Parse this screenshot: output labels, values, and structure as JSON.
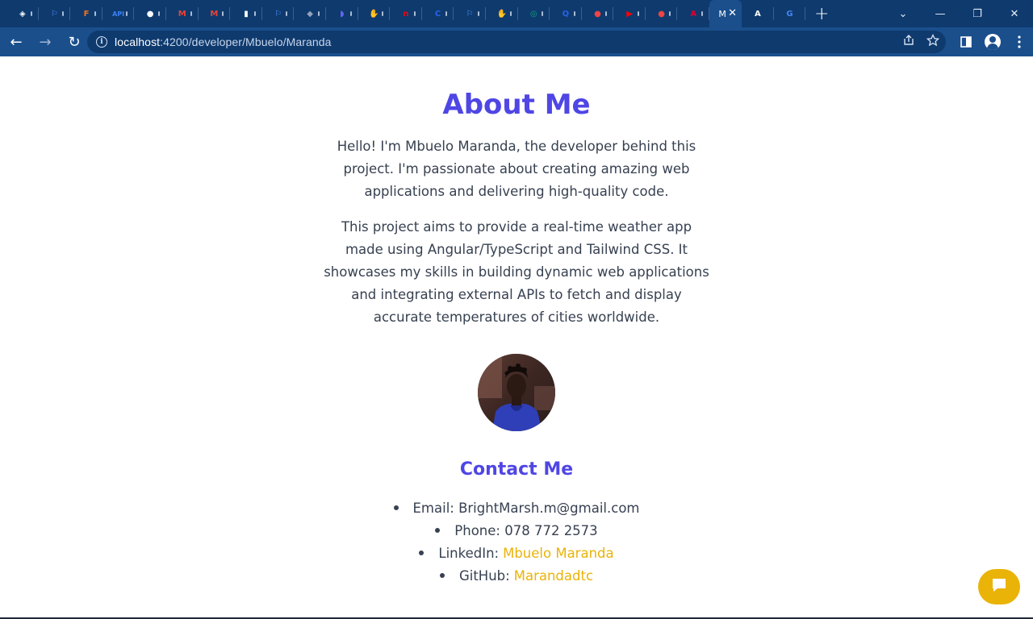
{
  "browser": {
    "tabs": [
      {
        "icon": "green-hexagon-icon",
        "color": "#ffffff",
        "glyph": "◈"
      },
      {
        "icon": "flag-icon",
        "color": "#4d8ef7",
        "glyph": "⚐"
      },
      {
        "icon": "f-app-icon",
        "color": "#f97316",
        "glyph": "F"
      },
      {
        "icon": "api-icon",
        "color": "#3b82f6",
        "glyph": "API"
      },
      {
        "icon": "github-icon",
        "color": "#ffffff",
        "glyph": "●"
      },
      {
        "icon": "gmail-icon",
        "color": "#ea4335",
        "glyph": "M"
      },
      {
        "icon": "gmail-icon",
        "color": "#ea4335",
        "glyph": "M"
      },
      {
        "icon": "document-icon",
        "color": "#ffffff",
        "glyph": "▮"
      },
      {
        "icon": "flag-icon",
        "color": "#4d8ef7",
        "glyph": "⚐"
      },
      {
        "icon": "layers-icon",
        "color": "#94a3b8",
        "glyph": "◆"
      },
      {
        "icon": "teams-icon",
        "color": "#6366f1",
        "glyph": "◗"
      },
      {
        "icon": "hand-icon",
        "color": "#fb923c",
        "glyph": "✋"
      },
      {
        "icon": "netflix-icon",
        "color": "#e50914",
        "glyph": "n"
      },
      {
        "icon": "circle-c-icon",
        "color": "#2563eb",
        "glyph": "C"
      },
      {
        "icon": "flag-icon",
        "color": "#4d8ef7",
        "glyph": "⚐"
      },
      {
        "icon": "hand-icon",
        "color": "#facc15",
        "glyph": "✋"
      },
      {
        "icon": "openai-icon",
        "color": "#10a37f",
        "glyph": "◎"
      },
      {
        "icon": "q-icon",
        "color": "#2563eb",
        "glyph": "Q"
      },
      {
        "icon": "helmet-icon",
        "color": "#ef4444",
        "glyph": "●"
      },
      {
        "icon": "youtube-icon",
        "color": "#ff0000",
        "glyph": "▶"
      },
      {
        "icon": "helmet-icon",
        "color": "#ef4444",
        "glyph": "●"
      },
      {
        "icon": "angular-icon",
        "color": "#dd0031",
        "glyph": "A"
      }
    ],
    "active_tab": {
      "label": "M",
      "close": "✕"
    },
    "after_tabs": [
      {
        "icon": "a-logo-icon",
        "color": "#ffffff",
        "glyph": "A"
      },
      {
        "icon": "google-icon",
        "color": "#4285f4",
        "glyph": "G"
      }
    ],
    "new_tab_glyph": "+",
    "window": {
      "tab_search": "⌄",
      "minimize": "—",
      "restore": "❐",
      "close": "✕"
    },
    "nav": {
      "back": "←",
      "forward": "→",
      "reload": "↻"
    },
    "address": {
      "host": "localhost",
      "path": ":4200/developer/Mbuelo/Maranda"
    }
  },
  "about": {
    "title": "About Me",
    "paragraph1": "Hello! I'm Mbuelo Maranda, the developer behind this project. I'm passionate about creating amazing web applications and delivering high-quality code.",
    "paragraph2": "This project aims to provide a real-time weather app made using Angular/TypeScript and Tailwind CSS. It showcases my skills in building dynamic web applications and integrating external APIs to fetch and display accurate temperatures of cities worldwide."
  },
  "contact": {
    "title": "Contact Me",
    "items": [
      {
        "label": "Email: BrightMarsh.m@gmail.com",
        "link": ""
      },
      {
        "label": "Phone: 078 772 2573",
        "link": ""
      },
      {
        "label": "LinkedIn:",
        "link": "Mbuelo Maranda"
      },
      {
        "label": "GitHub:",
        "link": "Marandadtc"
      }
    ]
  },
  "colors": {
    "accent": "#4f46e5",
    "link": "#eab308",
    "text": "#374151",
    "chrome": "#1a4f8c"
  }
}
